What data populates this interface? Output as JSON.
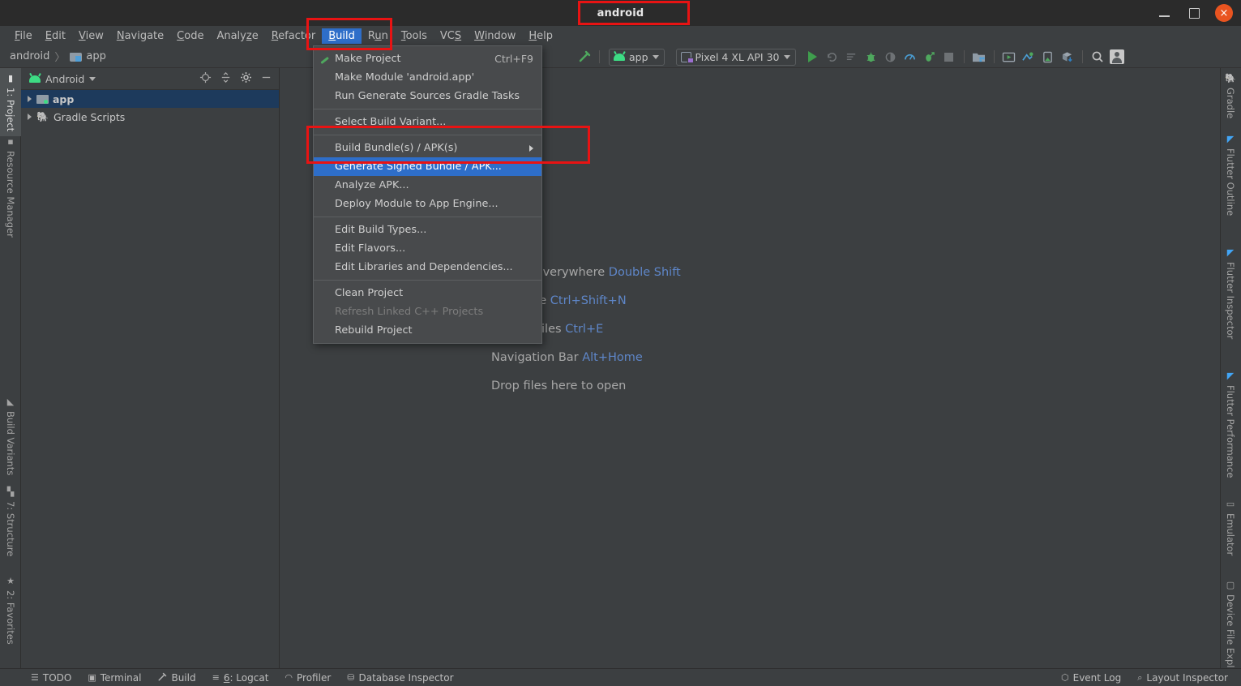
{
  "window": {
    "title": "android",
    "buttons": {
      "minimize": "minimize-icon",
      "maximize": "maximize-icon",
      "close": "×"
    }
  },
  "menubar": {
    "items": [
      {
        "label": "File",
        "mnemonic": "F"
      },
      {
        "label": "Edit",
        "mnemonic": "E"
      },
      {
        "label": "View",
        "mnemonic": "V"
      },
      {
        "label": "Navigate",
        "mnemonic": "N"
      },
      {
        "label": "Code",
        "mnemonic": "C"
      },
      {
        "label": "Analyze",
        "mnemonic": "z"
      },
      {
        "label": "Refactor",
        "mnemonic": "R"
      },
      {
        "label": "Build",
        "mnemonic": "B",
        "active": true
      },
      {
        "label": "Run",
        "mnemonic": "u"
      },
      {
        "label": "Tools",
        "mnemonic": "T"
      },
      {
        "label": "VCS",
        "mnemonic": "S"
      },
      {
        "label": "Window",
        "mnemonic": "W"
      },
      {
        "label": "Help",
        "mnemonic": "H"
      }
    ],
    "highlight_color": "#e81313"
  },
  "breadcrumb": {
    "project": "android",
    "separator": "〉",
    "module": "app"
  },
  "toolbar": {
    "build_hammer_icon": "hammer-icon",
    "run_config": {
      "label": "app",
      "icon": "android-icon"
    },
    "device": {
      "label": "Pixel 4 XL API 30",
      "icon": "device-icon"
    },
    "icons": [
      "run-icon",
      "apply-changes-icon",
      "apply-code-changes-icon",
      "debug-icon",
      "attach-debugger-icon",
      "profiler-icon",
      "run-with-coverage-icon",
      "stop-icon",
      "sdk-manager-icon",
      "avd-manager-icon",
      "device-manager-icon",
      "layout-inspector-icon",
      "device-file-explorer-icon",
      "search-icon",
      "avatar-icon"
    ]
  },
  "left_tool_strip": {
    "tabs": [
      {
        "label": "1: Project",
        "mnemonic": "1",
        "icon": "project-icon",
        "selected": true
      },
      {
        "label": "Resource Manager",
        "icon": "resource-manager-icon",
        "selected": false
      },
      {
        "label": "Build Variants",
        "icon": "build-variants-icon",
        "selected": false
      },
      {
        "label": "7: Structure",
        "mnemonic": "7",
        "icon": "structure-icon",
        "selected": false
      },
      {
        "label": "2: Favorites",
        "mnemonic": "2",
        "icon": "favorites-star-icon",
        "selected": false
      }
    ]
  },
  "right_tool_strip": {
    "tabs": [
      {
        "label": "Gradle",
        "icon": "gradle-elephant-icon"
      },
      {
        "label": "Flutter Outline",
        "icon": "flutter-icon"
      },
      {
        "label": "Flutter Inspector",
        "icon": "flutter-icon"
      },
      {
        "label": "Flutter Performance",
        "icon": "flutter-icon"
      },
      {
        "label": "Emulator",
        "icon": "emulator-icon"
      },
      {
        "label": "Device File Explorer",
        "icon": "device-file-explorer-icon"
      }
    ]
  },
  "project_panel": {
    "view_selector": "Android",
    "view_icon": "android-icon",
    "actions": [
      "select-opened-file-icon",
      "collapse-all-icon",
      "settings-gear-icon",
      "hide-icon"
    ],
    "tree": [
      {
        "label": "app",
        "icon": "module-icon",
        "selected": true,
        "expandable": true,
        "bold": true
      },
      {
        "label": "Gradle Scripts",
        "icon": "gradle-icon",
        "selected": false,
        "expandable": true,
        "bold": false
      }
    ]
  },
  "editor": {
    "welcome_lines": [
      {
        "text": "Search Everywhere",
        "shortcut": "Double Shift"
      },
      {
        "text": "Go to File",
        "shortcut": "Ctrl+Shift+N"
      },
      {
        "text": "Recent Files",
        "shortcut": "Ctrl+E"
      },
      {
        "text": "Navigation Bar",
        "shortcut": "Alt+Home"
      },
      {
        "text": "Drop files here to open",
        "shortcut": ""
      }
    ]
  },
  "build_menu": {
    "items": [
      {
        "label": "Make Project",
        "shortcut": "Ctrl+F9",
        "icon": "hammer-icon",
        "type": "item"
      },
      {
        "label": "Make Module 'android.app'",
        "shortcut": "",
        "type": "item"
      },
      {
        "label": "Run Generate Sources Gradle Tasks",
        "shortcut": "",
        "type": "item"
      },
      {
        "type": "separator"
      },
      {
        "label": "Select Build Variant...",
        "shortcut": "",
        "type": "item"
      },
      {
        "type": "separator"
      },
      {
        "label": "Build Bundle(s) / APK(s)",
        "shortcut": "",
        "type": "item",
        "submenu": true
      },
      {
        "label": "Generate Signed Bundle / APK...",
        "shortcut": "",
        "type": "item",
        "highlighted": true
      },
      {
        "label": "Analyze APK...",
        "shortcut": "",
        "type": "item"
      },
      {
        "label": "Deploy Module to App Engine...",
        "shortcut": "",
        "type": "item"
      },
      {
        "type": "separator"
      },
      {
        "label": "Edit Build Types...",
        "shortcut": "",
        "type": "item"
      },
      {
        "label": "Edit Flavors...",
        "shortcut": "",
        "type": "item"
      },
      {
        "label": "Edit Libraries and Dependencies...",
        "shortcut": "",
        "type": "item"
      },
      {
        "type": "separator"
      },
      {
        "label": "Clean Project",
        "shortcut": "",
        "type": "item"
      },
      {
        "label": "Refresh Linked C++ Projects",
        "shortcut": "",
        "type": "item",
        "disabled": true
      },
      {
        "label": "Rebuild Project",
        "shortcut": "",
        "type": "item"
      }
    ]
  },
  "statusbar": {
    "left_items": [
      {
        "label": "TODO",
        "icon": "todo-icon"
      },
      {
        "label": "Terminal",
        "icon": "terminal-icon"
      },
      {
        "label": "Build",
        "icon": "hammer-icon"
      },
      {
        "label": "6: Logcat",
        "mnemonic": "6",
        "icon": "logcat-icon"
      },
      {
        "label": "Profiler",
        "icon": "profiler-icon"
      },
      {
        "label": "Database Inspector",
        "icon": "database-icon"
      }
    ],
    "right_items": [
      {
        "label": "Event Log",
        "icon": "event-log-icon"
      },
      {
        "label": "Layout Inspector",
        "icon": "layout-inspector-icon"
      }
    ]
  }
}
